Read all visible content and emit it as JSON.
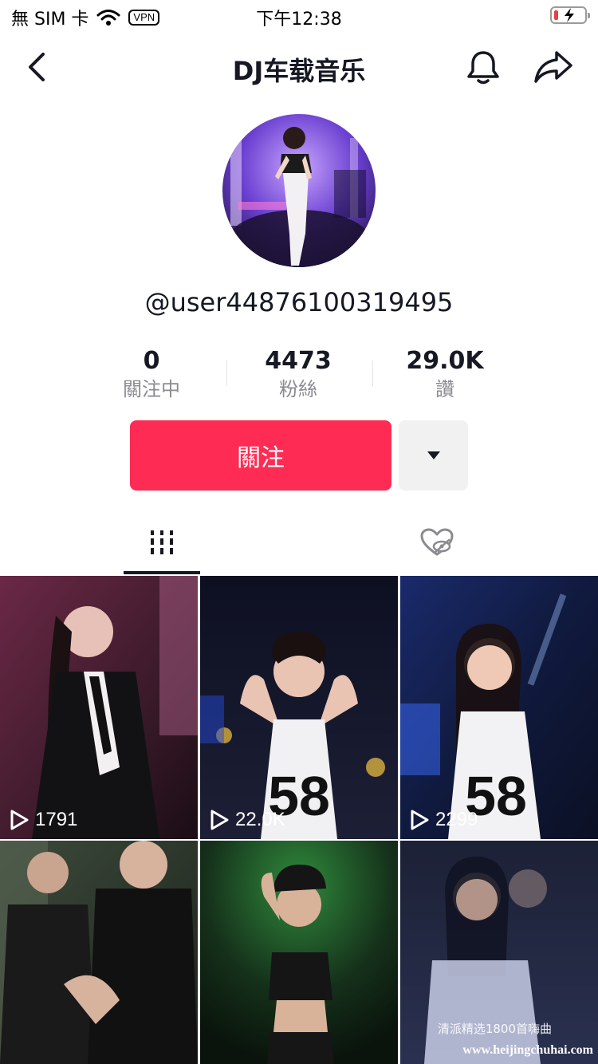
{
  "status_bar": {
    "carrier": "無 SIM 卡",
    "vpn": "VPN",
    "time": "下午12:38"
  },
  "nav": {
    "title": "DJ车载音乐",
    "icons": [
      "back-arrow-icon",
      "bell-icon",
      "share-icon"
    ]
  },
  "profile": {
    "username": "@user44876100319495",
    "stats": [
      {
        "value": "0",
        "label": "關注中"
      },
      {
        "value": "4473",
        "label": "粉絲"
      },
      {
        "value": "29.0K",
        "label": "讚"
      }
    ],
    "follow_label": "關注"
  },
  "tabs": [
    {
      "icon": "videos-grid-icon",
      "active": true
    },
    {
      "icon": "liked-heart-hidden-icon",
      "active": false
    }
  ],
  "videos": [
    {
      "views": "1791"
    },
    {
      "views": "22.0K"
    },
    {
      "views": "2299"
    },
    {
      "views": ""
    },
    {
      "views": ""
    },
    {
      "views": ""
    }
  ],
  "watermark": {
    "line1": "清派精选1800首嗨曲",
    "line2": "www.heijingchuhai.com"
  },
  "colors": {
    "accent": "#fe2c55",
    "secondary_button": "#f1f1f2"
  }
}
